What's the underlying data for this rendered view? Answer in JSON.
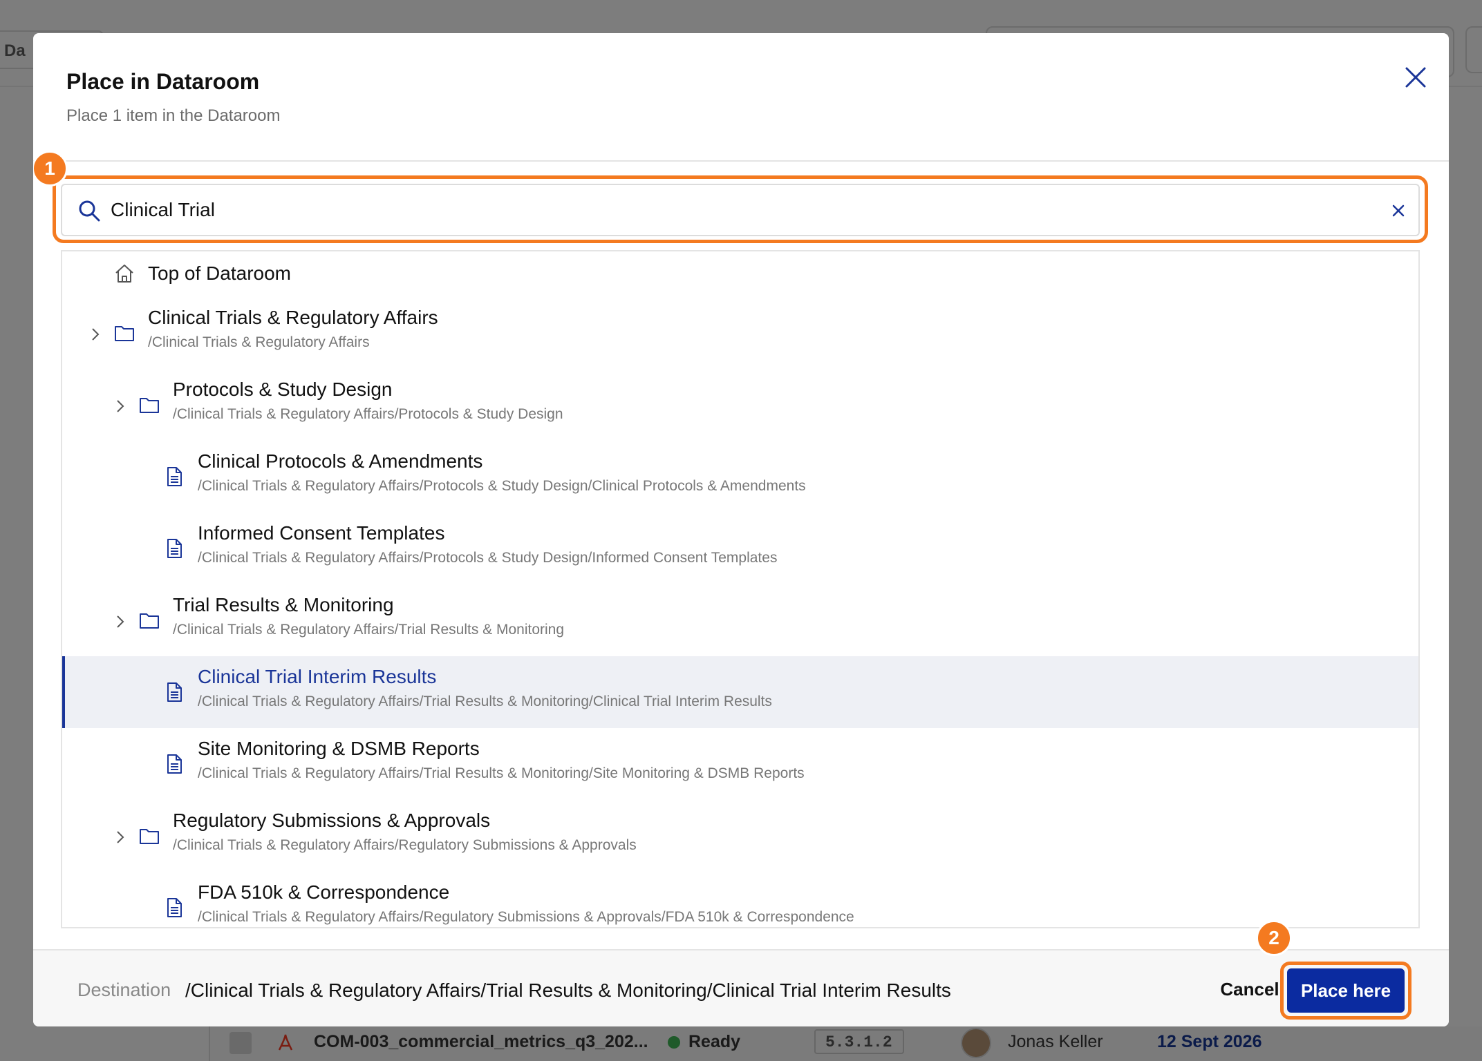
{
  "background": {
    "tab_label": "Da",
    "row": {
      "filename": "COM-003_commercial_metrics_q3_202...",
      "status": "Ready",
      "version": "5.3.1.2",
      "person": "Jonas Keller",
      "date": "12 Sept 2026"
    }
  },
  "modal": {
    "title": "Place in Dataroom",
    "subtitle": "Place 1 item in the Dataroom"
  },
  "search": {
    "value": "Clinical Trial",
    "badge": "1"
  },
  "tree": {
    "top_item": "Top of Dataroom",
    "items": [
      {
        "type": "folder",
        "title": "Clinical Trials & Regulatory Affairs",
        "path": "/Clinical Trials & Regulatory Affairs"
      },
      {
        "type": "folder",
        "title": "Protocols & Study Design",
        "path": "/Clinical Trials & Regulatory Affairs/Protocols & Study Design"
      },
      {
        "type": "document",
        "title": "Clinical Protocols & Amendments",
        "path": "/Clinical Trials & Regulatory Affairs/Protocols & Study Design/Clinical Protocols & Amendments"
      },
      {
        "type": "document",
        "title": "Informed Consent Templates",
        "path": "/Clinical Trials & Regulatory Affairs/Protocols & Study Design/Informed Consent Templates"
      },
      {
        "type": "folder",
        "title": "Trial Results & Monitoring",
        "path": "/Clinical Trials & Regulatory Affairs/Trial Results & Monitoring"
      },
      {
        "type": "document",
        "title": "Clinical Trial Interim Results",
        "path": "/Clinical Trials & Regulatory Affairs/Trial Results & Monitoring/Clinical Trial Interim Results",
        "selected": true
      },
      {
        "type": "document",
        "title": "Site Monitoring & DSMB Reports",
        "path": "/Clinical Trials & Regulatory Affairs/Trial Results & Monitoring/Site Monitoring & DSMB Reports"
      },
      {
        "type": "folder",
        "title": "Regulatory Submissions & Approvals",
        "path": "/Clinical Trials & Regulatory Affairs/Regulatory Submissions & Approvals"
      },
      {
        "type": "document",
        "title": "FDA 510k & Correspondence",
        "path": "/Clinical Trials & Regulatory Affairs/Regulatory Submissions & Approvals/FDA 510k & Correspondence"
      }
    ]
  },
  "footer": {
    "destination_label": "Destination",
    "destination_value": "/Clinical Trials & Regulatory Affairs/Trial Results & Monitoring/Clinical Trial Interim Results",
    "cancel_label": "Cancel",
    "place_label": "Place here",
    "badge": "2"
  },
  "colors": {
    "primary": "#0b2ba0",
    "highlight": "#f47a20",
    "selected_bg": "#eef0f5"
  }
}
